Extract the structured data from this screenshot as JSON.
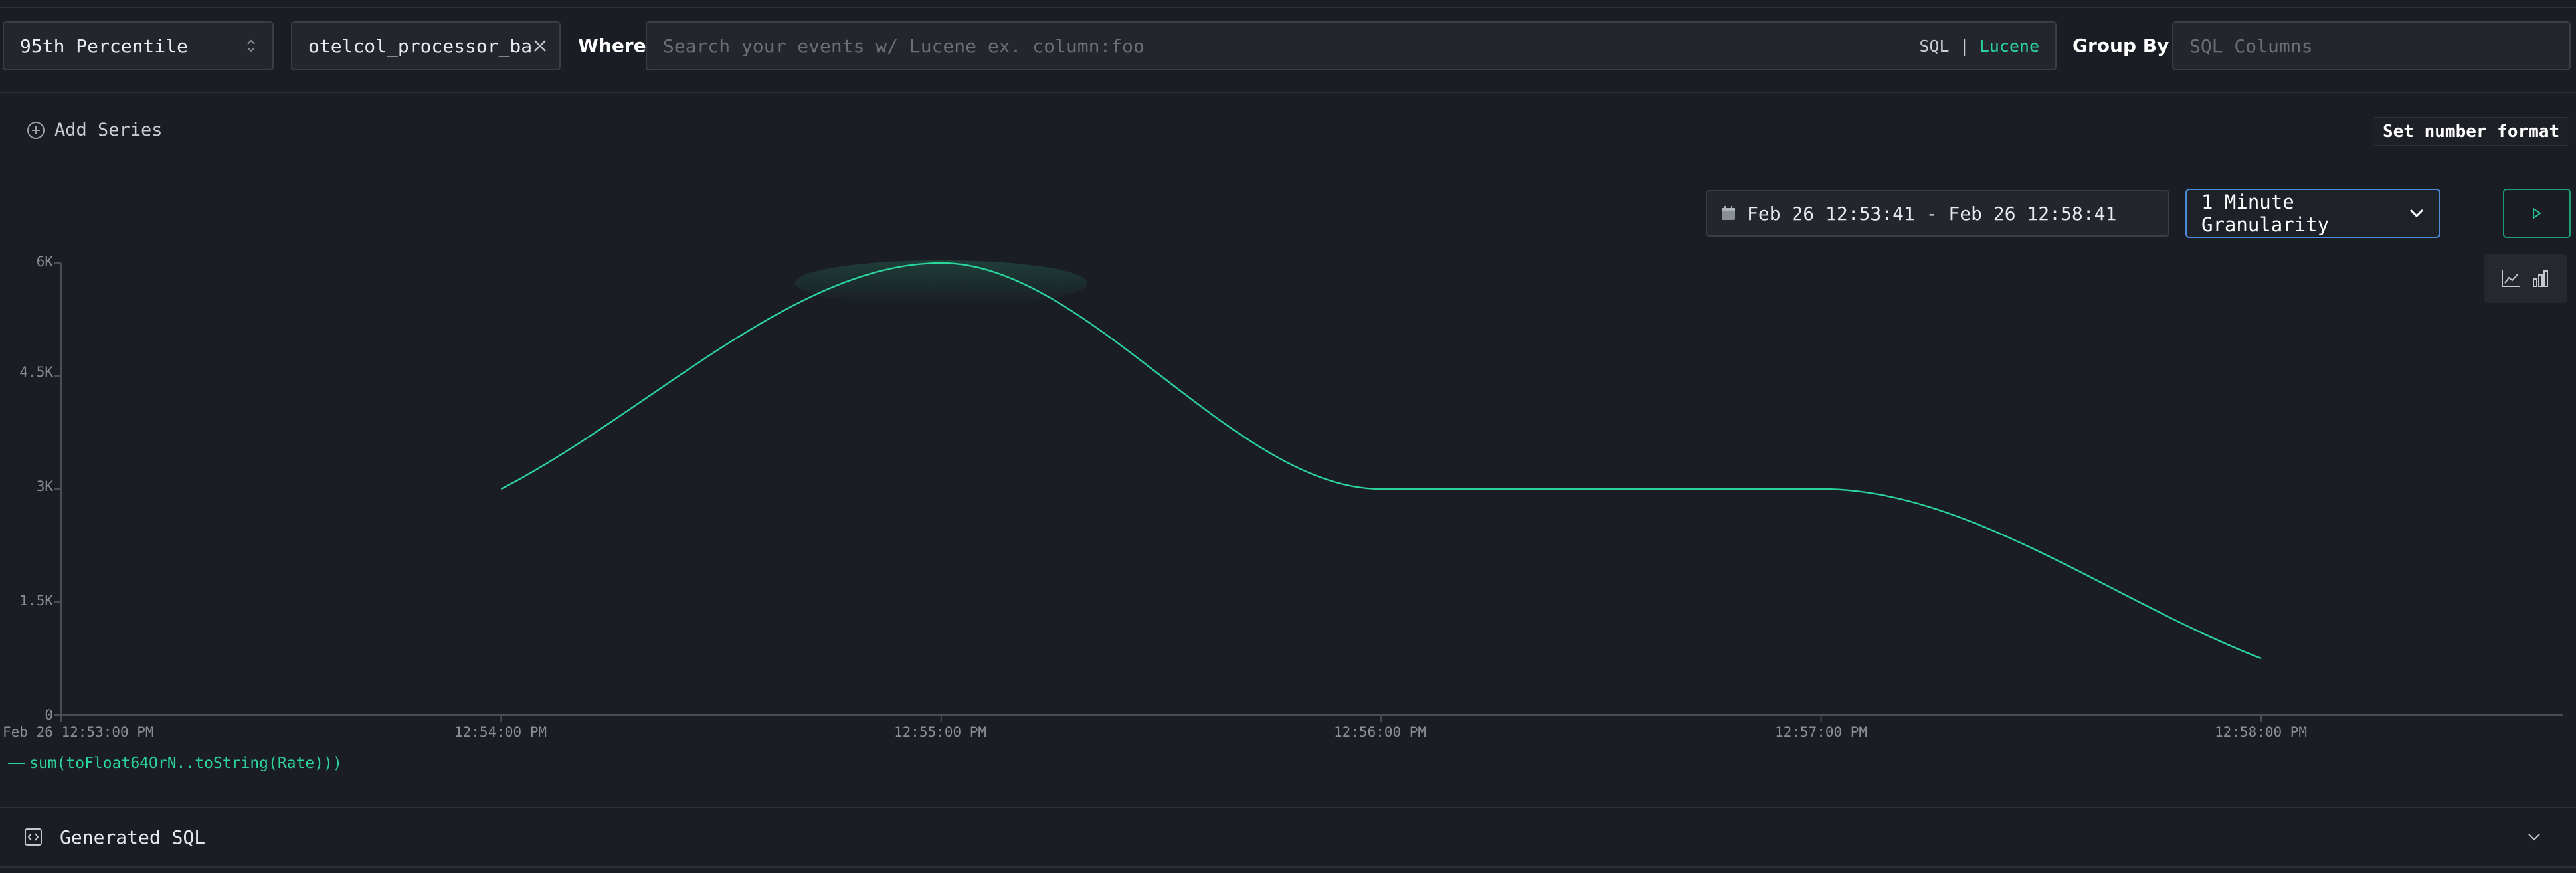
{
  "query": {
    "aggregation": "95th Percentile",
    "metric": "otelcol_processor_ba",
    "where_label": "Where",
    "search_placeholder": "Search your events w/ Lucene ex. column:foo",
    "sql_label": "SQL",
    "separator": "|",
    "lucene_label": "Lucene",
    "group_by_label": "Group By",
    "group_by_placeholder": "SQL Columns"
  },
  "series": {
    "add_series_label": "Add Series",
    "set_number_format_label": "Set number format"
  },
  "controls": {
    "time_range": "Feb 26 12:53:41 - Feb 26 12:58:41",
    "granularity": "1 Minute Granularity"
  },
  "chart_data": {
    "type": "line",
    "y_ticks": [
      "0",
      "1.5K",
      "3K",
      "4.5K",
      "6K"
    ],
    "ylim": [
      0,
      6000
    ],
    "x_ticks": [
      "Feb 26 12:53:00 PM",
      "12:54:00 PM",
      "12:55:00 PM",
      "12:56:00 PM",
      "12:57:00 PM",
      "12:58:00 PM"
    ],
    "series": [
      {
        "name": "sum(toFloat64OrN..toString(Rate)))",
        "color": "#2bd49a",
        "x": [
          "12:54:00 PM",
          "12:55:00 PM",
          "12:56:00 PM",
          "12:57:00 PM",
          "12:58:00 PM"
        ],
        "values": [
          3000,
          6000,
          3000,
          3000,
          750
        ]
      }
    ]
  },
  "footer": {
    "generated_sql_label": "Generated SQL"
  },
  "colors": {
    "accent": "#2bd49a",
    "background": "#1b1d24",
    "select_border": "#4a8cdb"
  }
}
